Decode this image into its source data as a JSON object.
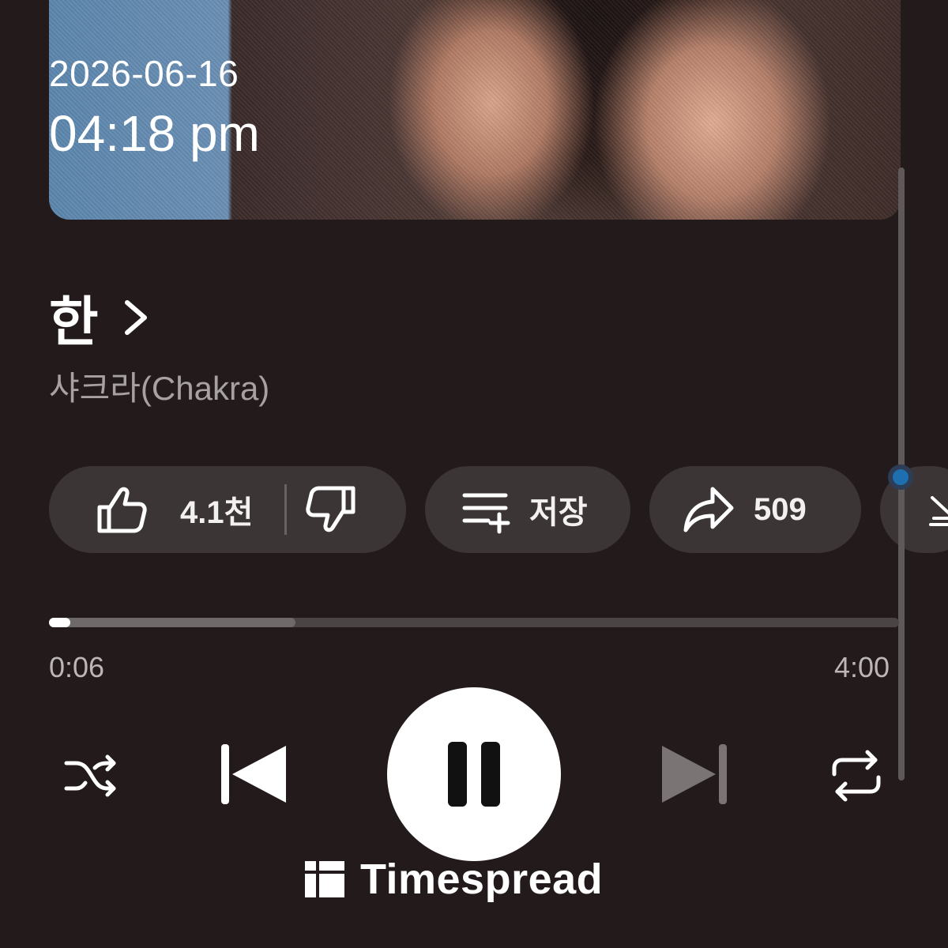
{
  "overlay": {
    "date": "2026-06-16",
    "time": "04:18 pm"
  },
  "song": {
    "title": "한",
    "artist": "샤크라(Chakra)"
  },
  "actions": {
    "like_count": "4.1천",
    "save_label": "저장",
    "share_count": "509"
  },
  "playback": {
    "current_time": "0:06",
    "total_time": "4:00",
    "progress_fraction": 0.025,
    "buffered_fraction": 0.29
  },
  "controls": {
    "shuffle_icon": "shuffle-icon",
    "previous_icon": "skip-previous-icon",
    "pause_icon": "pause-icon",
    "next_icon": "skip-next-icon",
    "repeat_icon": "repeat-icon"
  },
  "watermark": {
    "brand": "Timespread"
  },
  "colors": {
    "background": "#231b1b",
    "pill": "#3c3535",
    "scroll_dot": "#1e6fb0"
  }
}
